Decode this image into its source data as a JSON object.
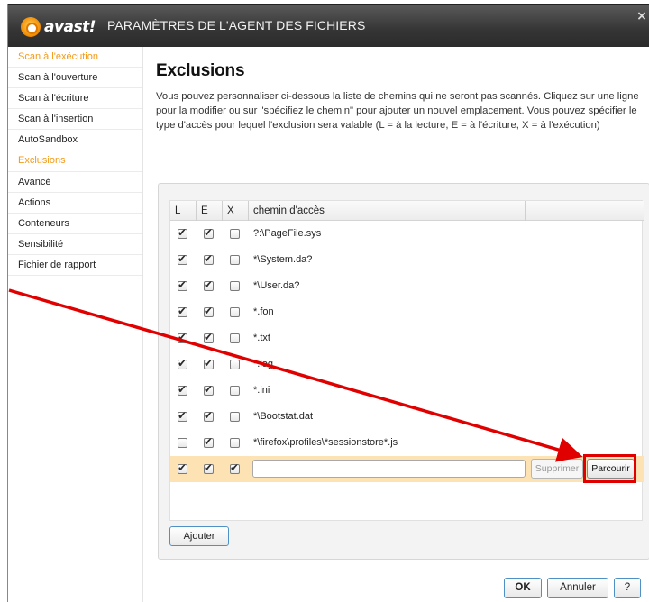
{
  "window": {
    "logo_text": "avast!",
    "title": "PARAMÈTRES DE L'AGENT DES FICHIERS",
    "close_glyph": "×"
  },
  "sidebar": {
    "items": [
      {
        "label": "Scan à l'exécution",
        "active": true
      },
      {
        "label": "Scan à l'ouverture",
        "active": false
      },
      {
        "label": "Scan à l'écriture",
        "active": false
      },
      {
        "label": "Scan à l'insertion",
        "active": false
      },
      {
        "label": "AutoSandbox",
        "active": false
      },
      {
        "label": "Exclusions",
        "active": true
      },
      {
        "label": "Avancé",
        "active": false
      },
      {
        "label": "Actions",
        "active": false
      },
      {
        "label": "Conteneurs",
        "active": false
      },
      {
        "label": "Sensibilité",
        "active": false
      },
      {
        "label": "Fichier de rapport",
        "active": false
      }
    ],
    "active_color": "#f39a16"
  },
  "main": {
    "title": "Exclusions",
    "description": "Vous pouvez personnaliser ci-dessous la liste de chemins qui ne seront pas scannés. Cliquez sur une ligne pour la modifier ou sur \"spécifiez le chemin\" pour ajouter un nouvel emplacement. Vous pouvez spécifier le type d'accès pour lequel l'exclusion sera valable (L = à la lecture, E = à l'écriture, X = à l'exécution)"
  },
  "table": {
    "columns": [
      "L",
      "E",
      "X",
      "chemin d'accès"
    ],
    "rows": [
      {
        "L": true,
        "E": true,
        "X": false,
        "path": "?:\\PageFile.sys"
      },
      {
        "L": true,
        "E": true,
        "X": false,
        "path": "*\\System.da?"
      },
      {
        "L": true,
        "E": true,
        "X": false,
        "path": "*\\User.da?"
      },
      {
        "L": true,
        "E": true,
        "X": false,
        "path": "*.fon"
      },
      {
        "L": true,
        "E": true,
        "X": false,
        "path": "*.txt"
      },
      {
        "L": true,
        "E": true,
        "X": false,
        "path": "*.log"
      },
      {
        "L": true,
        "E": true,
        "X": false,
        "path": "*.ini"
      },
      {
        "L": true,
        "E": true,
        "X": false,
        "path": "*\\Bootstat.dat"
      },
      {
        "L": false,
        "E": true,
        "X": false,
        "path": "*\\firefox\\profiles\\*sessionstore*.js"
      }
    ],
    "edit_row": {
      "L": true,
      "E": true,
      "X": true,
      "path_value": "",
      "delete_label": "Supprimer",
      "browse_label": "Parcourir"
    },
    "selected_row_color": "#fde2b3"
  },
  "buttons": {
    "add": "Ajouter",
    "ok": "OK",
    "cancel": "Annuler",
    "help": "?"
  },
  "annotation": {
    "color": "#e10000"
  }
}
